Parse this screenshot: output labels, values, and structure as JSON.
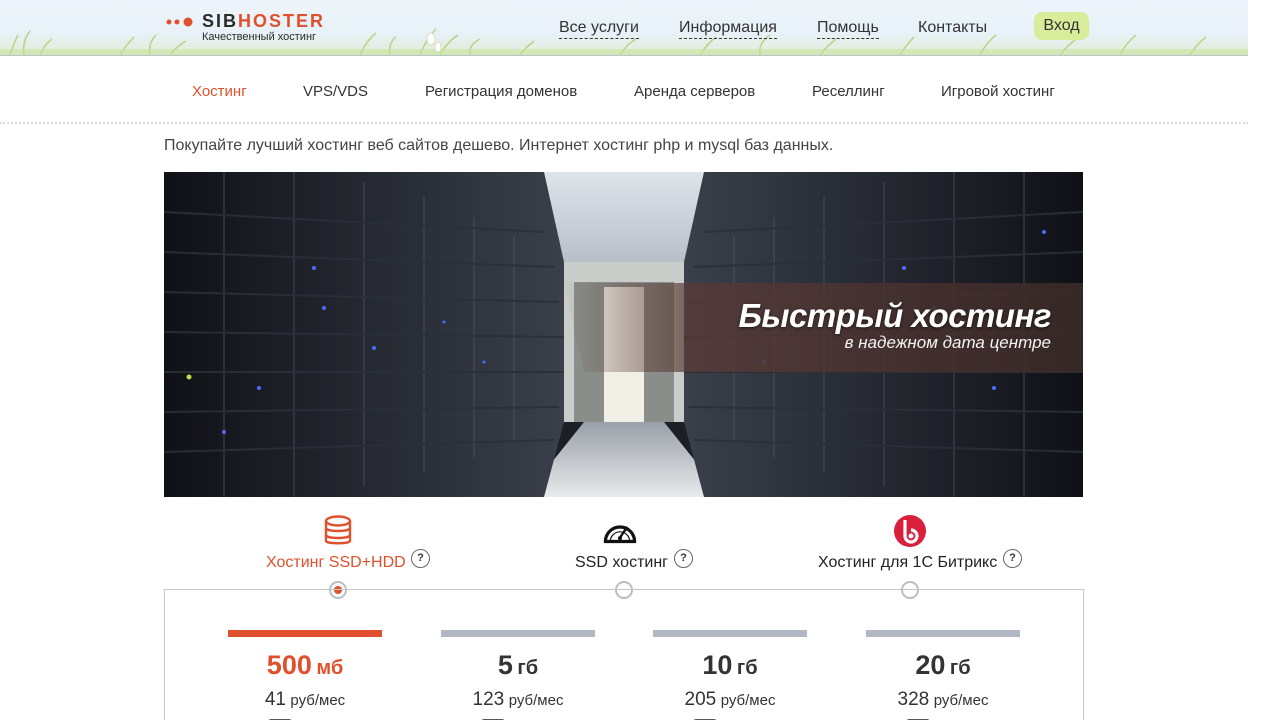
{
  "header": {
    "logo": {
      "brand_part1": "SIB",
      "brand_part2": "HOSTER",
      "tagline": "Качественный хостинг"
    },
    "nav": [
      {
        "label": "Все услуги",
        "dotted": true
      },
      {
        "label": "Информация",
        "dotted": true
      },
      {
        "label": "Помощь",
        "dotted": true
      },
      {
        "label": "Контакты",
        "dotted": false
      }
    ],
    "login_label": "Вход"
  },
  "subnav": {
    "items": [
      {
        "label": "Хостинг",
        "active": true
      },
      {
        "label": "VPS/VDS",
        "active": false
      },
      {
        "label": "Регистрация доменов",
        "active": false
      },
      {
        "label": "Аренда серверов",
        "active": false
      },
      {
        "label": "Реселлинг",
        "active": false
      },
      {
        "label": "Игровой хостинг",
        "active": false
      }
    ]
  },
  "intro": "Покупайте лучший хостинг веб сайтов дешево. Интернет хостинг php и mysql баз данных.",
  "banner": {
    "title": "Быстрый хостинг",
    "subtitle": "в надежном дата центре"
  },
  "plan_types": [
    {
      "label": "Хостинг SSD+HDD",
      "icon": "database-icon",
      "help": "?",
      "selected": true
    },
    {
      "label": "SSD хостинг",
      "icon": "speedometer-icon",
      "help": "?",
      "selected": false
    },
    {
      "label": "Хостинг для 1С Битрикс",
      "icon": "bitrix-logo-icon",
      "help": "?",
      "selected": false
    }
  ],
  "plans": [
    {
      "size": "500",
      "unit": "мб",
      "price": "41",
      "per": "руб/мес",
      "active": true
    },
    {
      "size": "5",
      "unit": "гб",
      "price": "123",
      "per": "руб/мес",
      "active": false
    },
    {
      "size": "10",
      "unit": "гб",
      "price": "205",
      "per": "руб/мес",
      "active": false
    },
    {
      "size": "20",
      "unit": "гб",
      "price": "328",
      "per": "руб/мес",
      "active": false
    }
  ],
  "colors": {
    "accent": "#e0502c",
    "login_bg": "#d9ec9a",
    "inactive_bar": "#b1b8c4",
    "discount_green": "#22a35a"
  }
}
